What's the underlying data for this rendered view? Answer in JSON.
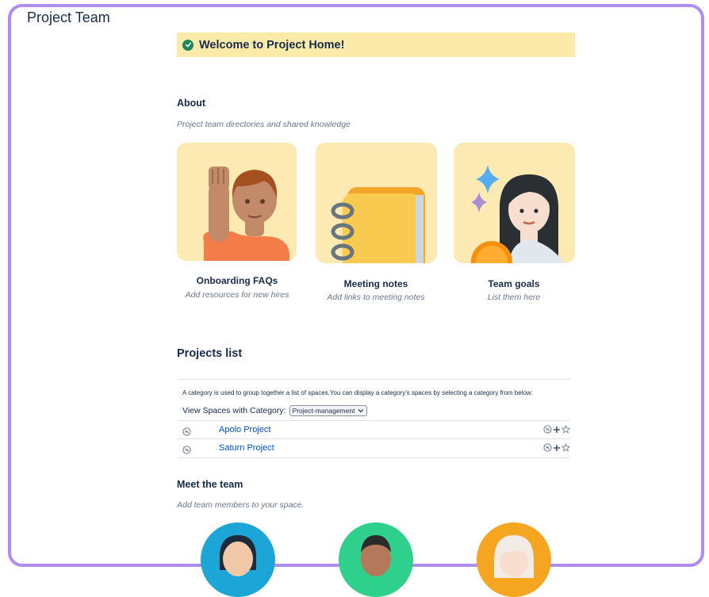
{
  "page_title": "Project Team",
  "banner": {
    "text": "Welcome to Project Home!"
  },
  "about": {
    "heading": "About",
    "subtitle": "Project team directories and shared knowledge",
    "cards": [
      {
        "title": "Onboarding FAQs",
        "description": "Add resources for new hires"
      },
      {
        "title": "Meeting notes",
        "description": "Add links to meeting notes"
      },
      {
        "title": "Team goals",
        "description": "List them here"
      }
    ]
  },
  "projects": {
    "heading": "Projects list",
    "category_note": "A category is used to group together a list of spaces.You can display a category's spaces by selecting a category from below:",
    "category_label": "View Spaces with Category:",
    "category_selected": "Project-management",
    "items": [
      {
        "name": "Apolo Project"
      },
      {
        "name": "Saturn Project"
      }
    ]
  },
  "team": {
    "heading": "Meet the team",
    "subtitle": "Add team members to your space."
  },
  "icons": [
    "check-circle-icon",
    "space-icon",
    "watch-icon",
    "add-icon",
    "star-icon",
    "chevron-down-icon"
  ],
  "colors": {
    "banner_bg": "#fceaa9",
    "link": "#0052cc",
    "frame": "#b18cf0",
    "success": "#1f845a"
  }
}
